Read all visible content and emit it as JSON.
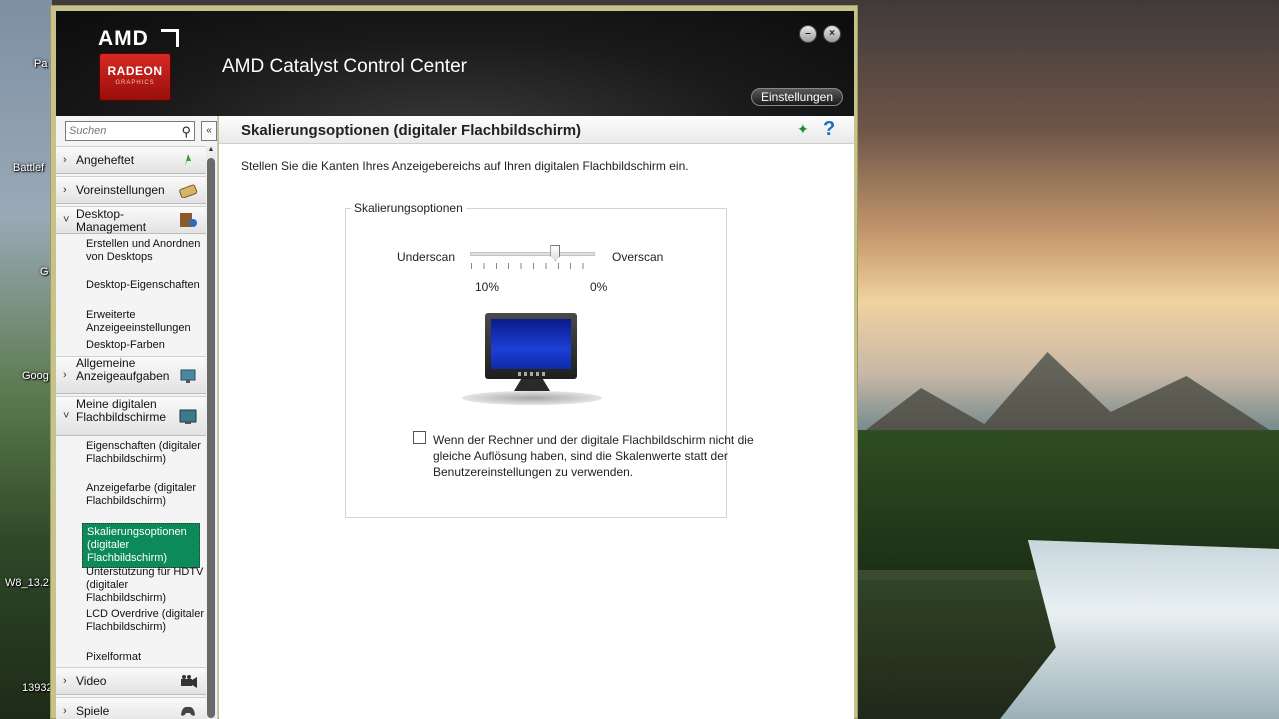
{
  "desktop": {
    "icons": [
      {
        "label": "Pa",
        "x": 0
      },
      {
        "label": "Battlef",
        "x": 1
      },
      {
        "label": "G",
        "x": 2
      },
      {
        "label": "Goog",
        "x": 3
      },
      {
        "label": "W8_13.2",
        "x": 4
      },
      {
        "label": "13932",
        "x": 5
      }
    ]
  },
  "window": {
    "brand_top": "AMD",
    "brand_badge": "RADEON",
    "brand_sub": "GRAPHICS",
    "title": "AMD Catalyst Control Center",
    "minimize_glyph": "–",
    "close_glyph": "×",
    "settings_label": "Einstellungen"
  },
  "sidebar": {
    "search_placeholder": "Suchen",
    "search_icon_glyph": "⚲",
    "collapse_glyph": "«",
    "scroll_up_glyph": "▲",
    "categories": [
      {
        "label": "Angeheftet",
        "chevron": "›"
      },
      {
        "label": "Voreinstellungen",
        "chevron": "›"
      },
      {
        "label": "Desktop-Management",
        "chevron": "˅"
      },
      {
        "label": "Allgemeine Anzeigeaufgaben",
        "chevron": "›"
      },
      {
        "label": "Meine digitalen Flachbildschirme",
        "chevron": "˅"
      },
      {
        "label": "Video",
        "chevron": "›"
      },
      {
        "label": "Spiele",
        "chevron": "›"
      }
    ],
    "desktop_sub": [
      "Erstellen und Anordnen von Desktops",
      "Desktop-Eigenschaften",
      "Erweiterte Anzeigeeinstellungen",
      "Desktop-Farben"
    ],
    "flat_sub": [
      "Eigenschaften (digitaler Flachbildschirm)",
      "Anzeigefarbe (digitaler Flachbildschirm)",
      "Skalierungsoptionen (digitaler Flachbildschirm)",
      "Unterstützung für HDTV (digitaler Flachbildschirm)",
      "LCD Overdrive (digitaler Flachbildschirm)",
      "Pixelformat"
    ]
  },
  "main": {
    "title": "Skalierungsoptionen (digitaler Flachbildschirm)",
    "pin_glyph": "✦",
    "help_glyph": "?",
    "description": "Stellen Sie die Kanten Ihres Anzeigebereichs auf Ihren digitalen Flachbildschirm ein.",
    "group_title": "Skalierungsoptionen",
    "slider": {
      "left_label": "Underscan",
      "right_label": "Overscan",
      "min_label": "10%",
      "max_label": "0%",
      "value_fraction": 0.68
    },
    "checkbox_text": "Wenn der Rechner und der digitale Flachbildschirm nicht die gleiche Auflösung haben, sind die Skalenwerte statt der Benutzereinstellungen zu verwenden.",
    "checkbox_checked": false
  }
}
